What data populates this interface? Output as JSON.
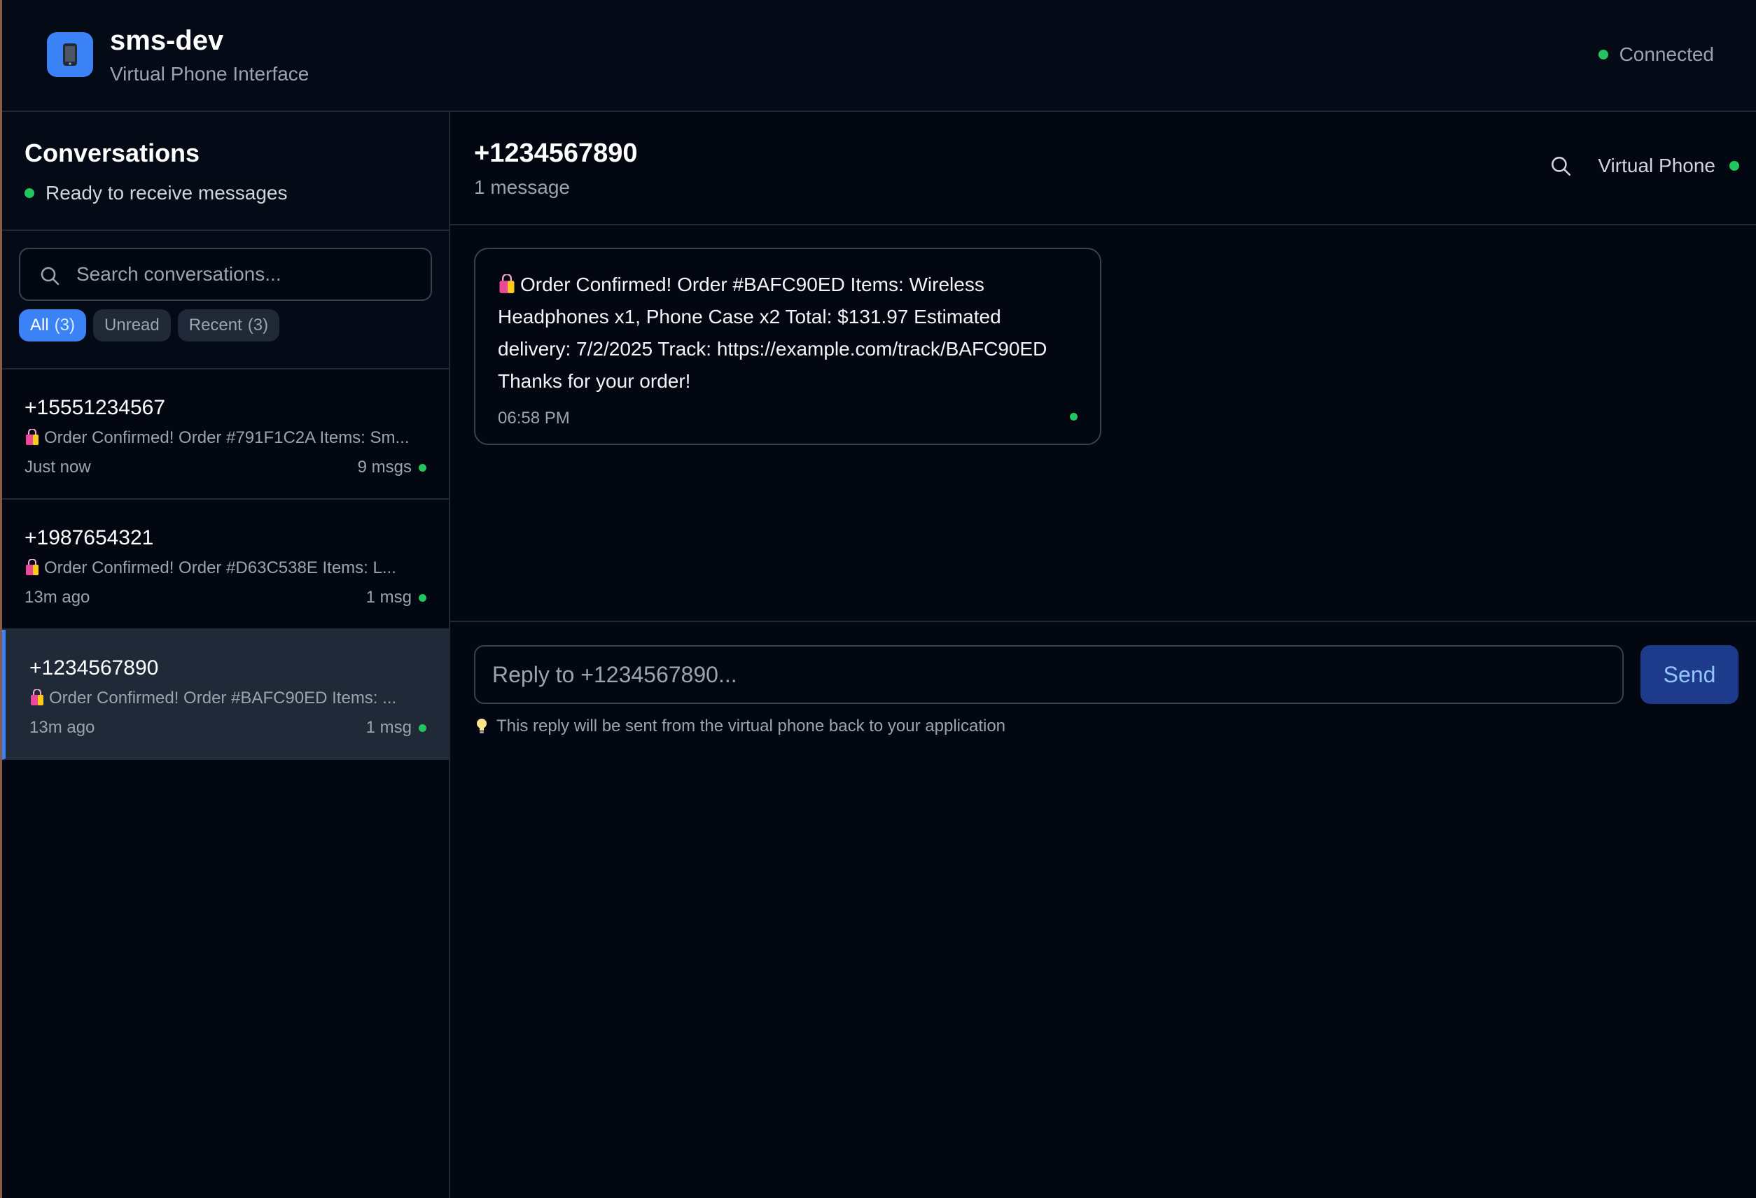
{
  "header": {
    "app_title": "sms-dev",
    "app_subtitle": "Virtual Phone Interface",
    "connection_status": "Connected",
    "logo_icon": "phone-icon"
  },
  "sidebar": {
    "title": "Conversations",
    "status": "Ready to receive messages",
    "search_placeholder": "Search conversations...",
    "filters": [
      {
        "label": "All",
        "count": "(3)",
        "active": true
      },
      {
        "label": "Unread",
        "count": "",
        "active": false
      },
      {
        "label": "Recent",
        "count": "(3)",
        "active": false
      }
    ],
    "conversations": [
      {
        "number": "+15551234567",
        "preview": "Order Confirmed! Order #791F1C2A Items: Sm...",
        "time": "Just now",
        "count": "9 msgs",
        "selected": false
      },
      {
        "number": "+1987654321",
        "preview": "Order Confirmed! Order #D63C538E Items: L...",
        "time": "13m ago",
        "count": "1 msg",
        "selected": false
      },
      {
        "number": "+1234567890",
        "preview": "Order Confirmed! Order #BAFC90ED Items: ...",
        "time": "13m ago",
        "count": "1 msg",
        "selected": true
      }
    ]
  },
  "chat": {
    "number": "+1234567890",
    "message_count": "1 message",
    "virtual_phone_label": "Virtual Phone",
    "messages": [
      {
        "text": "Order Confirmed! Order #BAFC90ED Items: Wireless Headphones x1, Phone Case x2 Total: $131.97 Estimated delivery: 7/2/2025 Track: https://example.com/track/BAFC90ED Thanks for your order!",
        "time": "06:58 PM"
      }
    ],
    "reply_placeholder": "Reply to +1234567890...",
    "send_label": "Send",
    "hint": "This reply will be sent from the virtual phone back to your application"
  },
  "colors": {
    "accent": "#3b82f6",
    "status_green": "#22c55e",
    "background": "#030712"
  }
}
